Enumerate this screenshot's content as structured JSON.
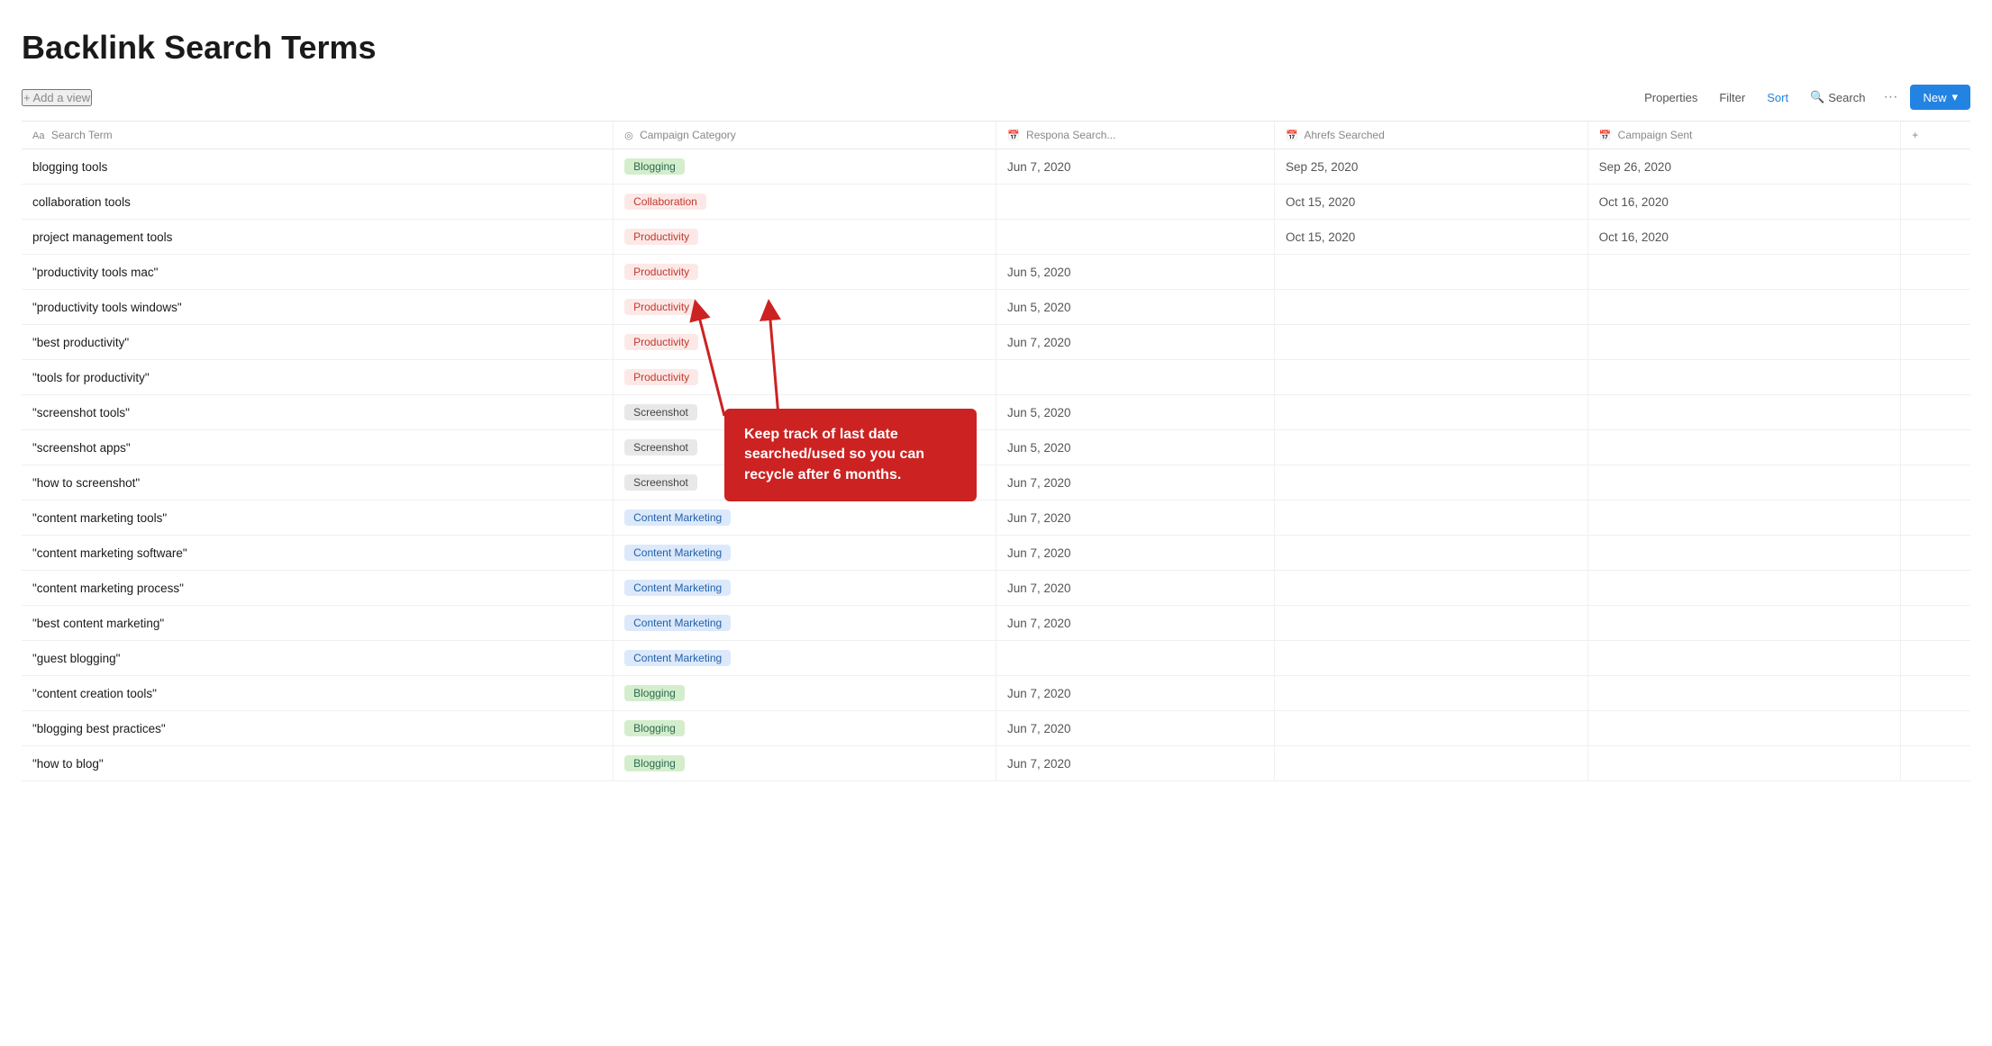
{
  "page": {
    "title": "Backlink Search Terms"
  },
  "toolbar": {
    "add_view": "+ Add a view",
    "properties": "Properties",
    "filter": "Filter",
    "sort": "Sort",
    "search": "Search",
    "new": "New"
  },
  "table": {
    "columns": [
      {
        "id": "search_term",
        "icon": "Aa",
        "label": "Search Term"
      },
      {
        "id": "category",
        "icon": "◎",
        "label": "Campaign Category"
      },
      {
        "id": "respona",
        "icon": "📅",
        "label": "Respona Search..."
      },
      {
        "id": "ahrefs",
        "icon": "📅",
        "label": "Ahrefs Searched"
      },
      {
        "id": "campaign",
        "icon": "📅",
        "label": "Campaign Sent"
      },
      {
        "id": "plus",
        "icon": "+",
        "label": ""
      }
    ],
    "rows": [
      {
        "search_term": "blogging tools",
        "category": "Blogging",
        "category_class": "tag-blogging",
        "respona": "Jun 7, 2020",
        "ahrefs": "Sep 25, 2020",
        "campaign": "Sep 26, 2020"
      },
      {
        "search_term": "collaboration tools",
        "category": "Collaboration",
        "category_class": "tag-collaboration",
        "respona": "",
        "ahrefs": "Oct 15, 2020",
        "campaign": "Oct 16, 2020"
      },
      {
        "search_term": "project management tools",
        "category": "Productivity",
        "category_class": "tag-productivity",
        "respona": "",
        "ahrefs": "Oct 15, 2020",
        "campaign": "Oct 16, 2020"
      },
      {
        "search_term": "\"productivity tools mac\"",
        "category": "Productivity",
        "category_class": "tag-productivity",
        "respona": "Jun 5, 2020",
        "ahrefs": "",
        "campaign": ""
      },
      {
        "search_term": "\"productivity tools windows\"",
        "category": "Productivity",
        "category_class": "tag-productivity",
        "respona": "Jun 5, 2020",
        "ahrefs": "",
        "campaign": ""
      },
      {
        "search_term": "\"best productivity\"",
        "category": "Productivity",
        "category_class": "tag-productivity",
        "respona": "Jun 7, 2020",
        "ahrefs": "",
        "campaign": ""
      },
      {
        "search_term": "\"tools for productivity\"",
        "category": "Productivity",
        "category_class": "tag-productivity",
        "respona": "",
        "ahrefs": "",
        "campaign": ""
      },
      {
        "search_term": "\"screenshot tools\"",
        "category": "Screenshot",
        "category_class": "tag-screenshot",
        "respona": "Jun 5, 2020",
        "ahrefs": "",
        "campaign": ""
      },
      {
        "search_term": "\"screenshot apps\"",
        "category": "Screenshot",
        "category_class": "tag-screenshot",
        "respona": "Jun 5, 2020",
        "ahrefs": "",
        "campaign": ""
      },
      {
        "search_term": "\"how to screenshot\"",
        "category": "Screenshot",
        "category_class": "tag-screenshot",
        "respona": "Jun 7, 2020",
        "ahrefs": "",
        "campaign": ""
      },
      {
        "search_term": "\"content marketing tools\"",
        "category": "Content Marketing",
        "category_class": "tag-content-marketing",
        "respona": "Jun 7, 2020",
        "ahrefs": "",
        "campaign": ""
      },
      {
        "search_term": "\"content marketing software\"",
        "category": "Content Marketing",
        "category_class": "tag-content-marketing",
        "respona": "Jun 7, 2020",
        "ahrefs": "",
        "campaign": ""
      },
      {
        "search_term": "\"content marketing process\"",
        "category": "Content Marketing",
        "category_class": "tag-content-marketing",
        "respona": "Jun 7, 2020",
        "ahrefs": "",
        "campaign": ""
      },
      {
        "search_term": "\"best content marketing\"",
        "category": "Content Marketing",
        "category_class": "tag-content-marketing",
        "respona": "Jun 7, 2020",
        "ahrefs": "",
        "campaign": ""
      },
      {
        "search_term": "\"guest blogging\"",
        "category": "Content Marketing",
        "category_class": "tag-content-marketing",
        "respona": "",
        "ahrefs": "",
        "campaign": ""
      },
      {
        "search_term": "\"content creation tools\"",
        "category": "Blogging",
        "category_class": "tag-blogging",
        "respona": "Jun 7, 2020",
        "ahrefs": "",
        "campaign": ""
      },
      {
        "search_term": "\"blogging best practices\"",
        "category": "Blogging",
        "category_class": "tag-blogging",
        "respona": "Jun 7, 2020",
        "ahrefs": "",
        "campaign": ""
      },
      {
        "search_term": "\"how to blog\"",
        "category": "Blogging",
        "category_class": "tag-blogging",
        "respona": "Jun 7, 2020",
        "ahrefs": "",
        "campaign": ""
      }
    ]
  },
  "annotation": {
    "text": "Keep track of last date searched/used so you can recycle after 6 months."
  }
}
